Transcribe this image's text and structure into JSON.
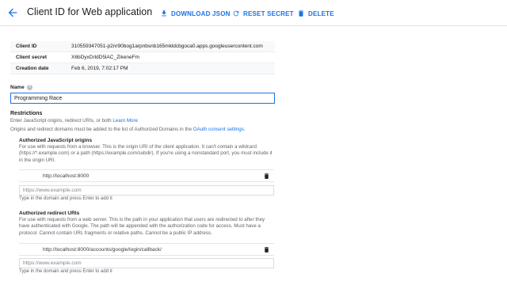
{
  "header": {
    "title": "Client ID for Web application",
    "download_label": "DOWNLOAD JSON",
    "reset_label": "RESET SECRET",
    "delete_label": "DELETE"
  },
  "info": {
    "client_id_label": "Client ID",
    "client_id_value": "310559347051-p2nr90bog1arpnbsnb165mkldcbgoca0.apps.googleusercontent.com",
    "client_secret_label": "Client secret",
    "client_secret_value": "X6bDyxDrldD5lAC_ZikeneFm",
    "creation_date_label": "Creation date",
    "creation_date_value": "Feb 6, 2019, 7:02:17 PM"
  },
  "name": {
    "label": "Name",
    "value": "Programming Race"
  },
  "restrictions": {
    "heading": "Restrictions",
    "line1_text": "Enter JavaScript origins, redirect URIs, or both",
    "learn_more": "Learn More",
    "line2_text": "Origins and redirect domains must be added to the list of Authorized Domains in the",
    "consent_link": "OAuth consent settings",
    "line2_end": "."
  },
  "js_origins": {
    "title": "Authorized JavaScript origins",
    "description": "For use with requests from a browser. This is the origin URI of the client application. It can't contain a wildcard (https://*.example.com) or a path (https://example.com/subdir). If you're using a nonstandard port, you must include it in the origin URI.",
    "uri": "http://localhost:8000",
    "placeholder": "https://www.example.com",
    "hint": "Type in the domain and press Enter to add it"
  },
  "redirect_uris": {
    "title": "Authorized redirect URIs",
    "description": "For use with requests from a web server. This is the path in your application that users are redirected to after they have authenticated with Google. The path will be appended with the authorization code for access. Must have a protocol. Cannot contain URL fragments or relative paths. Cannot be a public IP address.",
    "uri": "http://localhost:8000/accounts/google/login/callback/",
    "placeholder": "https://www.example.com",
    "hint": "Type in the domain and press Enter to add it"
  },
  "colors": {
    "accent": "#1a73e8",
    "text": "#202124",
    "muted": "#5f6368"
  },
  "icons": [
    "back-arrow-icon",
    "download-icon",
    "refresh-icon",
    "trash-icon",
    "help-icon"
  ]
}
